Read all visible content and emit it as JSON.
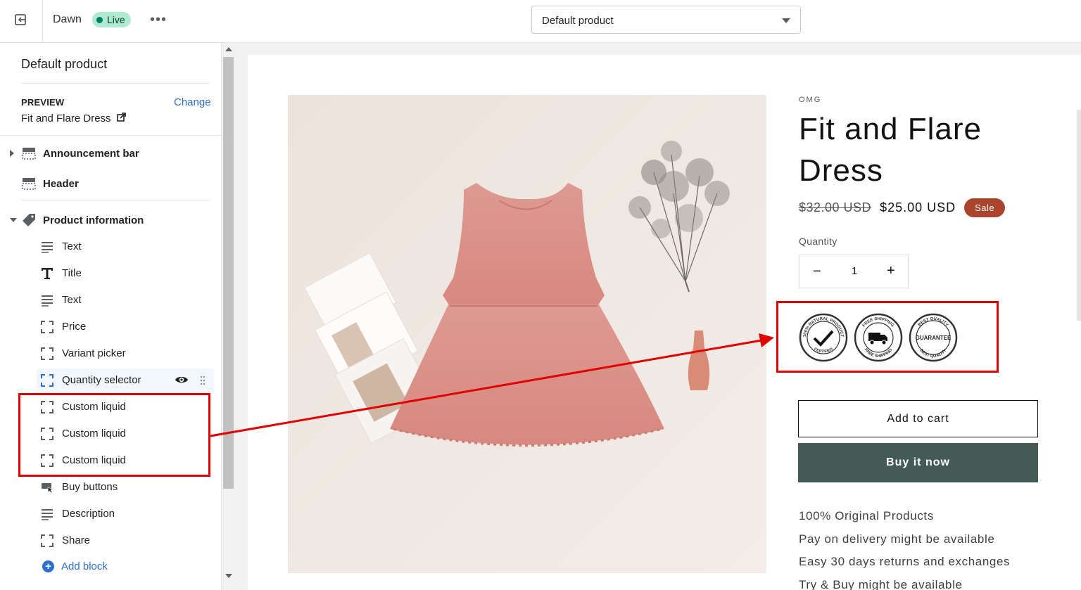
{
  "topbar": {
    "theme_name": "Dawn",
    "live_label": "Live",
    "more_label": "•••",
    "template_select": "Default product"
  },
  "sidebar": {
    "title": "Default product",
    "preview_label": "PREVIEW",
    "preview_change": "Change",
    "preview_value": "Fit and Flare Dress",
    "sections": {
      "announcement": "Announcement bar",
      "header": "Header",
      "product_info": "Product information"
    },
    "blocks": [
      {
        "label": "Text",
        "icon": "text-lines-icon"
      },
      {
        "label": "Title",
        "icon": "title-t-icon"
      },
      {
        "label": "Text",
        "icon": "text-lines-icon"
      },
      {
        "label": "Price",
        "icon": "block-frame-icon"
      },
      {
        "label": "Variant picker",
        "icon": "block-frame-icon"
      },
      {
        "label": "Quantity selector",
        "icon": "block-frame-icon"
      },
      {
        "label": "Custom liquid",
        "icon": "block-frame-icon"
      },
      {
        "label": "Custom liquid",
        "icon": "block-frame-icon"
      },
      {
        "label": "Custom liquid",
        "icon": "block-frame-icon"
      },
      {
        "label": "Buy buttons",
        "icon": "buy-buttons-icon"
      },
      {
        "label": "Description",
        "icon": "text-lines-icon"
      },
      {
        "label": "Share",
        "icon": "block-frame-icon"
      }
    ],
    "add_block": "Add block"
  },
  "product": {
    "vendor": "OMG",
    "title": "Fit and Flare Dress",
    "old_price": "$32.00 USD",
    "price": "$25.00 USD",
    "sale_badge": "Sale",
    "quantity_label": "Quantity",
    "quantity_value": "1",
    "quantity_minus": "−",
    "quantity_plus": "+",
    "trust_badges": [
      {
        "top_text": "100% NATURAL PRODUCT",
        "bottom_text": "CERTIFIED",
        "icon": "checkmark-icon"
      },
      {
        "top_text": "FREE SHIPPING",
        "bottom_text": "FREE SHIPPING",
        "icon": "truck-icon"
      },
      {
        "top_text": "BEST QUALITY",
        "bottom_text": "BEST QUALITY",
        "center_text": "GUARANTEE",
        "icon": "guarantee-icon"
      }
    ],
    "add_to_cart": "Add to cart",
    "buy_now": "Buy it now",
    "features": [
      "100% Original Products",
      "Pay on delivery might be available",
      "Easy 30 days returns and exchanges",
      "Try & Buy might be available"
    ]
  },
  "colors": {
    "annotation_red": "#e00000",
    "buy_button": "#445a56",
    "sale_badge": "#a8452c",
    "live_badge": "#aee9d1",
    "link_blue": "#2c6ecb"
  }
}
